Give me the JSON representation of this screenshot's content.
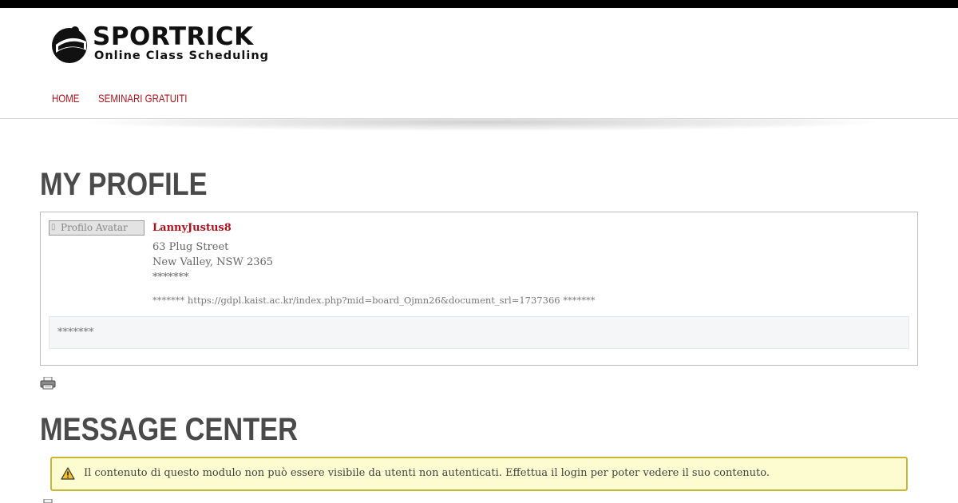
{
  "brand": {
    "name": "SPORTRICK",
    "tagline": "Online Class Scheduling"
  },
  "nav": {
    "items": [
      {
        "label": "HOME"
      },
      {
        "label": "SEMINARI GRATUITI"
      }
    ]
  },
  "profile": {
    "heading": "MY PROFILE",
    "avatar_alt": "Profilo Avatar",
    "username": "LannyJustus8",
    "address_line1": "63 Plug Street",
    "address_line2": "New Valley, NSW 2365",
    "masked_field": "*******",
    "website_line": "******* https://gdpl.kaist.ac.kr/index.php?mid=board_Ojmn26&document_srl=1737366 *******",
    "about_text": "*******",
    "print_icon": "printer-icon"
  },
  "message_center": {
    "heading": "MESSAGE CENTER",
    "alert_icon": "warning-icon",
    "alert_text": "Il contenuto di questo modulo non può essere visibile da utenti non autenticati. Effettua il login per poter vedere il suo contenuto."
  },
  "colors": {
    "accent": "#b0111a",
    "heading": "#4a4a4a",
    "alert_bg": "#fcfcd0",
    "alert_border": "#c5b73a"
  }
}
